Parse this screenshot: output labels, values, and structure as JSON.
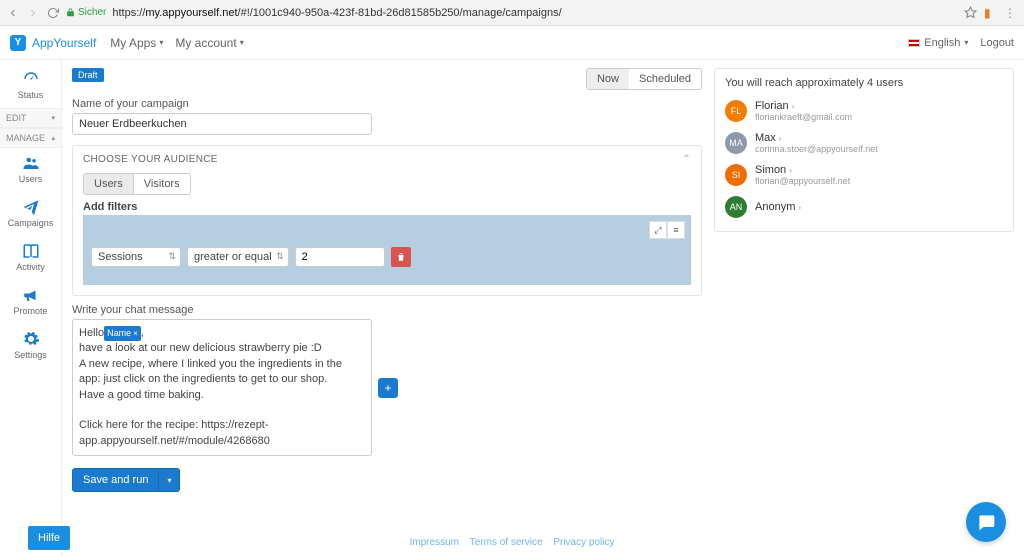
{
  "chrome": {
    "secure_label": "Sicher",
    "url_host": "my.appyourself.net",
    "url_path": "/#!/1001c940-950a-423f-81bd-26d81585b250/manage/campaigns/"
  },
  "topbar": {
    "brand": "AppYourself",
    "my_apps": "My Apps",
    "my_account": "My account",
    "language": "English",
    "logout": "Logout"
  },
  "sidebar": {
    "status": "Status",
    "edit": "EDIT",
    "manage": "MANAGE",
    "users": "Users",
    "campaigns": "Campaigns",
    "activity": "Activity",
    "promote": "Promote",
    "settings": "Settings"
  },
  "campaign": {
    "draft_badge": "Draft",
    "seg_now": "Now",
    "seg_scheduled": "Scheduled",
    "name_label": "Name of your campaign",
    "name_value": "Neuer Erdbeerkuchen",
    "audience_header": "CHOOSE YOUR AUDIENCE",
    "tab_users": "Users",
    "tab_visitors": "Visitors",
    "filters_label": "Add filters",
    "filter_field": "Sessions",
    "filter_op": "greater or equal",
    "filter_value": "2",
    "msg_label": "Write your chat message",
    "msg_hello": "Hello",
    "msg_chip": "Name",
    "msg_punct": ",",
    "msg_l2": "have a look at our new delicious strawberry pie :D",
    "msg_l3": "A new recipe, where I linked you the ingredients in the app: just click on the ingredients to get to our shop.",
    "msg_l4": "Have a good time baking.",
    "msg_l5": "Click here for the recipe: https://rezept-app.appyourself.net/#/module/4268680",
    "save_run": "Save and run"
  },
  "reach": {
    "headline": "You will reach approximately 4 users",
    "users": [
      {
        "initials": "FL",
        "color": "#f57c00",
        "name": "Florian",
        "email": "floriankraeft@gmail.com"
      },
      {
        "initials": "MA",
        "color": "#8e9aab",
        "name": "Max",
        "email": "corinna.stoer@appyourself.net"
      },
      {
        "initials": "SI",
        "color": "#ef6c00",
        "name": "Simon",
        "email": "florian@appyourself.net"
      },
      {
        "initials": "AN",
        "color": "#2e7d32",
        "name": "Anonym",
        "email": ""
      }
    ]
  },
  "footer": {
    "impressum": "Impressum",
    "terms": "Terms of service",
    "privacy": "Privacy policy"
  },
  "help": {
    "label": "Hilfe"
  }
}
